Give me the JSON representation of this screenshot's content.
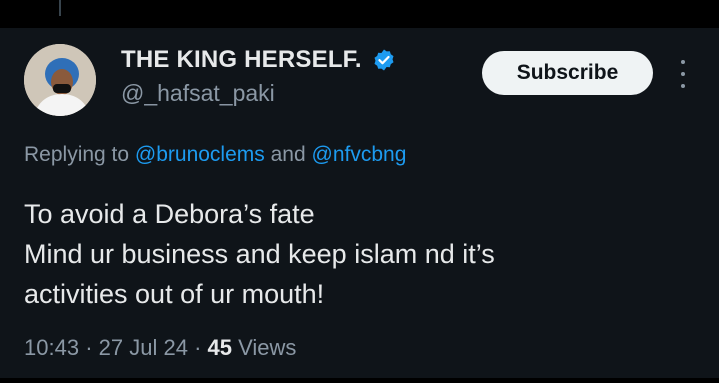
{
  "author": {
    "display_name": "THE KING HERSELF.",
    "handle": "@_hafsat_paki",
    "verified_icon": "verified-badge-icon",
    "avatar": "profile-avatar"
  },
  "actions": {
    "subscribe_label": "Subscribe",
    "more_icon": "more-options-icon"
  },
  "reply": {
    "prefix": "Replying to",
    "user1": "@brunoclems",
    "conjunction": "and",
    "user2": "@nfvcbng"
  },
  "tweet": {
    "lines": [
      "To avoid a Debora’s fate",
      "Mind ur business and keep islam nd it’s",
      "activities out of ur mouth!"
    ]
  },
  "meta": {
    "time": "10:43",
    "separator": "·",
    "date": "27 Jul 24",
    "views_count": "45",
    "views_label": "Views"
  },
  "colors": {
    "background": "#0f1419",
    "text": "#e7e9ea",
    "secondary": "#8b98a5",
    "link": "#1d9bf0",
    "verified": "#1d9bf0",
    "button_bg": "#eff3f4"
  }
}
